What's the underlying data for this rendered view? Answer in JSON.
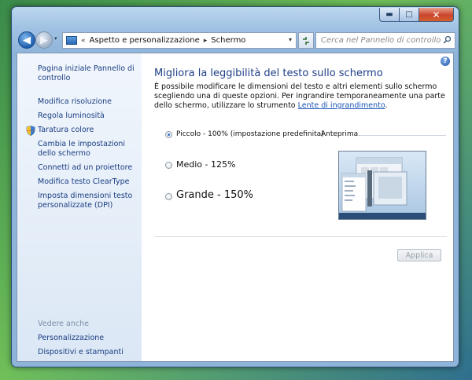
{
  "titlebar": {
    "minimize": "▬",
    "maximize": "□",
    "close": "✕"
  },
  "nav": {
    "back": "◀",
    "forward": "▶",
    "dropdown": "▾"
  },
  "address": {
    "prefix": "«",
    "crumbs": [
      "Aspetto e personalizzazione",
      "Schermo"
    ],
    "separator": "▸"
  },
  "search": {
    "placeholder": "Cerca nel Pannello di controllo"
  },
  "sidebar": {
    "home": "Pagina iniziale Pannello di controllo",
    "items": [
      "Modifica risoluzione",
      "Regola luminosità",
      "Taratura colore",
      "Cambia le impostazioni dello schermo",
      "Connetti ad un proiettore",
      "Modifica testo ClearType",
      "Imposta dimensioni testo personalizzate (DPI)"
    ],
    "see_also_label": "Vedere anche",
    "see_also": [
      "Personalizzazione",
      "Dispositivi e stampanti"
    ]
  },
  "main": {
    "title": "Migliora la leggibilità del testo sullo schermo",
    "description": "È possibile modificare le dimensioni del testo e altri elementi sullo schermo scegliendo una di queste opzioni. Per ingrandire temporaneamente una parte dello schermo, utilizzare lo strumento",
    "magnifier_link": "Lente di ingrandimento",
    "period": ".",
    "options": [
      {
        "label": "Piccolo - 100% (impostazione predefinita)",
        "selected": true
      },
      {
        "label": "Medio - 125%",
        "selected": false
      },
      {
        "label": "Grande - 150%",
        "selected": false
      }
    ],
    "preview_label": "Anteprima",
    "apply": "Applica"
  },
  "colors": {
    "link": "#1a3d83",
    "title": "#1e3f87",
    "selected_radio": "#2c6fc6"
  }
}
